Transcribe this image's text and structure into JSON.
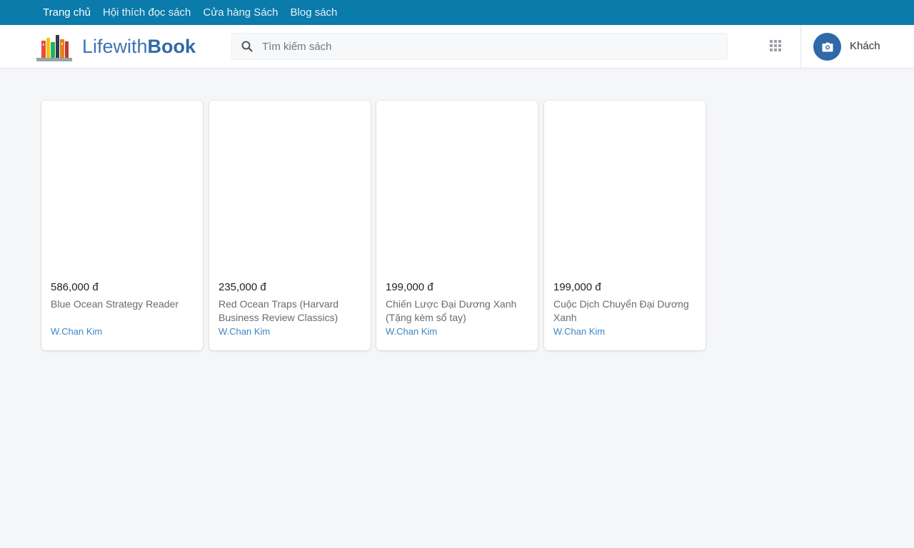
{
  "topnav": {
    "items": [
      {
        "label": "Trang chủ"
      },
      {
        "label": "Hội thích đọc sách"
      },
      {
        "label": "Cửa hàng Sách"
      },
      {
        "label": "Blog sách"
      }
    ]
  },
  "header": {
    "brand_light": "Lifewith",
    "brand_bold": "Book",
    "search_placeholder": "Tìm kiếm sách",
    "user_name": "Khách",
    "icons": {
      "logo": "books-shelf-icon",
      "search": "search-icon",
      "apps": "grid-icon",
      "avatar": "camera-icon"
    }
  },
  "colors": {
    "topnav_bg": "#0a7bab",
    "brand": "#2f69a8",
    "link": "#3d85c6",
    "page_bg": "#f5f6f8"
  },
  "books": [
    {
      "price": "586,000 đ",
      "title": "Blue Ocean Strategy Reader",
      "author": "W.Chan Kim"
    },
    {
      "price": "235,000 đ",
      "title": "Red Ocean Traps (Harvard Business Review Classics)",
      "author": "W.Chan Kim"
    },
    {
      "price": "199,000 đ",
      "title": "Chiến Lược Đại Dương Xanh (Tặng kèm sổ tay)",
      "author": "W.Chan Kim"
    },
    {
      "price": "199,000 đ",
      "title": "Cuộc Dịch Chuyển Đại Dương Xanh",
      "author": "W.Chan Kim"
    }
  ]
}
